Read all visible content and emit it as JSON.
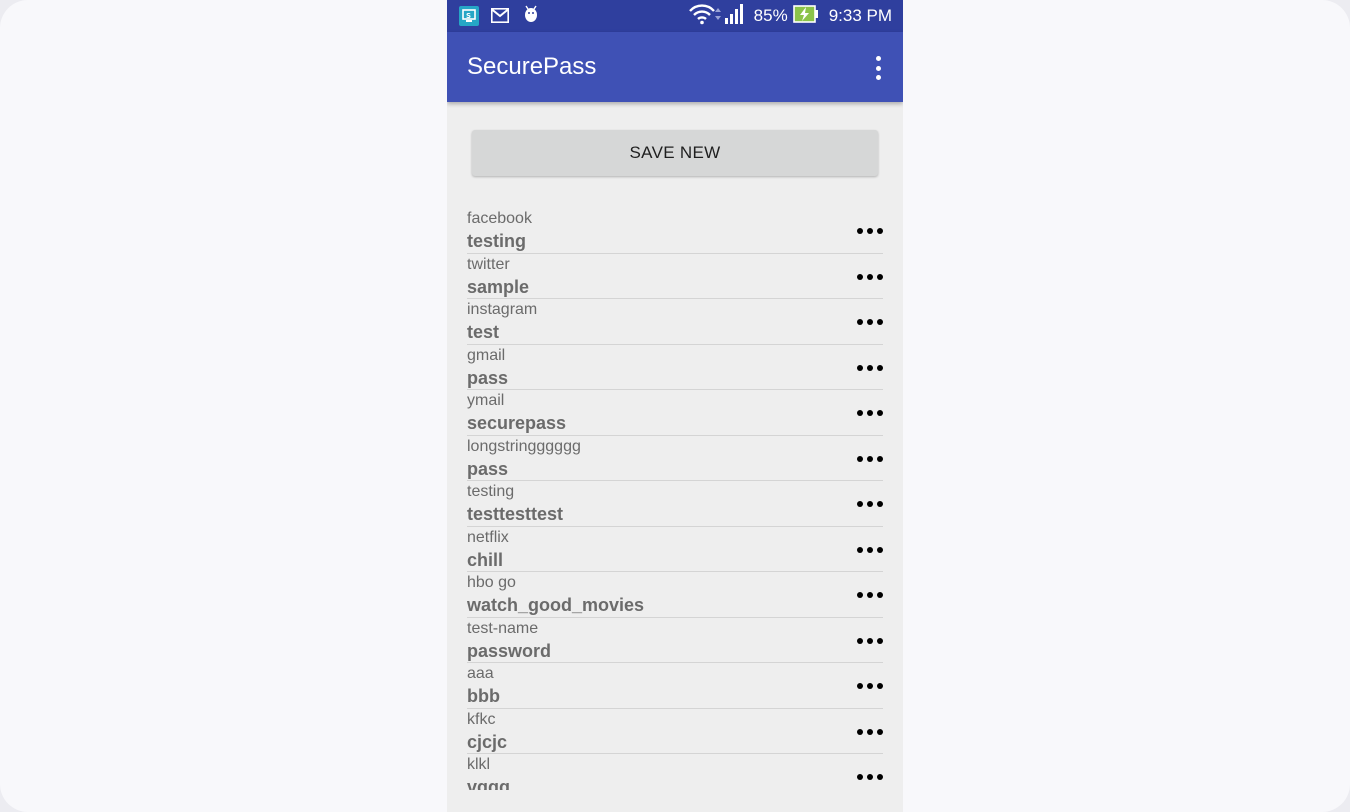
{
  "status_bar": {
    "battery_percent": "85%",
    "time": "9:33 PM",
    "icons": [
      "app-notification-icon",
      "gmail-icon",
      "android-debug-icon",
      "wifi-icon",
      "signal-icon",
      "battery-charging-icon"
    ],
    "colors": {
      "background": "#2f3f9e",
      "battery_fill": "#8bc34a"
    }
  },
  "app_bar": {
    "title": "SecurePass",
    "menu_icon": "overflow-menu-icon",
    "color": "#3f51b5"
  },
  "save_button": {
    "label": "SAVE NEW"
  },
  "entries": [
    {
      "name": "facebook",
      "password": "testing"
    },
    {
      "name": "twitter",
      "password": "sample"
    },
    {
      "name": "instagram",
      "password": "test"
    },
    {
      "name": "gmail",
      "password": "pass"
    },
    {
      "name": "ymail",
      "password": "securepass"
    },
    {
      "name": "longstringggggg",
      "password": "pass"
    },
    {
      "name": "testing",
      "password": "testtesttest"
    },
    {
      "name": "netflix",
      "password": "chill"
    },
    {
      "name": "hbo go",
      "password": "watch_good_movies"
    },
    {
      "name": "test-name",
      "password": "password"
    },
    {
      "name": "aaa",
      "password": "bbb"
    },
    {
      "name": "kfkc",
      "password": "cjcjc"
    },
    {
      "name": "klkl",
      "password": "vggg"
    }
  ]
}
